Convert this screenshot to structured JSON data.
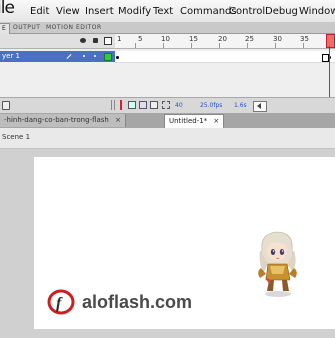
{
  "menubar": {
    "partial_item": "ile",
    "items": [
      "Edit",
      "View",
      "Insert",
      "Modify",
      "Text",
      "Commands",
      "Control",
      "Debug",
      "Window"
    ]
  },
  "panel_tabs": {
    "partial": "E",
    "output": "OUTPUT",
    "motion_editor": "MOTION EDITOR"
  },
  "timeline": {
    "frame_numbers": [
      "1",
      "5",
      "10",
      "15",
      "20",
      "25",
      "30",
      "35"
    ],
    "layer_name": "yer 1",
    "status": {
      "current_frame": "40",
      "fps": "25.0fps",
      "time": "1.6s"
    }
  },
  "doc_tabs": {
    "tab1": "-hinh-dang-co-ban-trong-flash",
    "tab1_close": "×",
    "tab2": "Untitled-1*",
    "tab2_close": "×"
  },
  "breadcrumb": {
    "scene": "Scene 1"
  },
  "stage": {
    "logo_text": "aloflash.com",
    "colors": {
      "logo_red": "#cc1f1f",
      "logo_text": "#4a4a4a",
      "layer_highlight": "#4c6fc4",
      "playhead": "#e02020"
    }
  }
}
